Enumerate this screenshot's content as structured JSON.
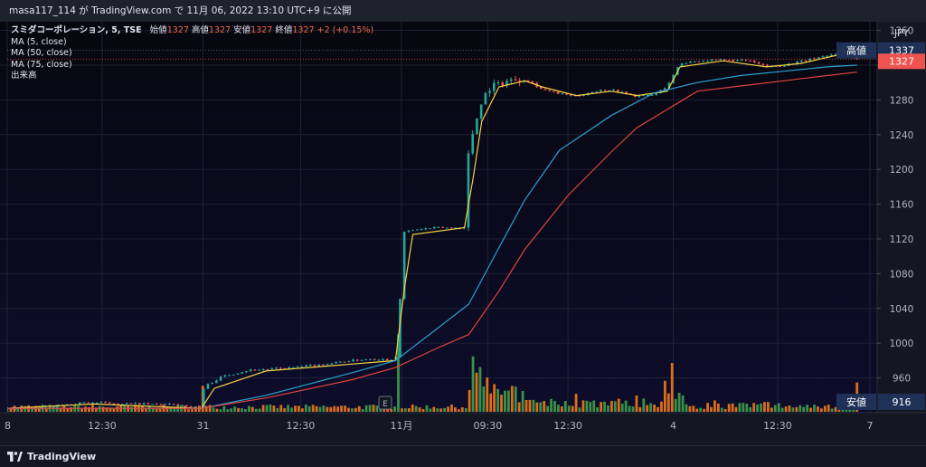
{
  "header": {
    "publish_info": "masa117_114 が TradingView.com で 11月 06, 2022 13:10 UTC+9 に公開"
  },
  "legend": {
    "symbol_line": "スミダコーポレーション, 5, TSE",
    "open_label": "始値",
    "open": "1327",
    "high_label": "高値",
    "high": "1327",
    "low_label": "安値",
    "low": "1327",
    "close_label": "終値",
    "close": "1327",
    "change": "+2 (+0.15%)",
    "ma5": "MA (5, close)",
    "ma50": "MA (50, close)",
    "ma75": "MA (75, close)",
    "volume": "出来高"
  },
  "footer": {
    "brand": "TradingView"
  },
  "colors": {
    "background": "#0d0d2b",
    "up": "#26a69a",
    "down": "#ef5350",
    "ma5": "#f5d142",
    "ma50": "#2aa1d1",
    "ma75": "#e0443d",
    "vol_up": "#3c9a4a",
    "vol_down": "#e8741a"
  },
  "chart_data": {
    "type": "candlestick",
    "title": "スミダコーポレーション, 5, TSE",
    "currency": "JPY",
    "ylim": [
      920,
      1370
    ],
    "y_ticks": [
      1360,
      1320,
      1280,
      1240,
      1200,
      1160,
      1120,
      1080,
      1040,
      1000,
      960
    ],
    "x_ticks": [
      {
        "label": "8",
        "t": 0
      },
      {
        "label": "12:30",
        "t": 0.11
      },
      {
        "label": "31",
        "t": 0.227
      },
      {
        "label": "12:30",
        "t": 0.34
      },
      {
        "label": "11月",
        "t": 0.457
      },
      {
        "label": "09:30",
        "t": 0.557
      },
      {
        "label": "12:30",
        "t": 0.65
      },
      {
        "label": "4",
        "t": 0.772
      },
      {
        "label": "12:30",
        "t": 0.893
      },
      {
        "label": "7",
        "t": 1.0
      }
    ],
    "price_labels": [
      {
        "name": "高値",
        "value": "1337"
      },
      {
        "name": "終値",
        "value": "1327"
      },
      {
        "name": "安値",
        "value": "916"
      }
    ],
    "ohlc_path": [
      [
        0,
        925
      ],
      [
        0.03,
        925
      ],
      [
        0.06,
        928
      ],
      [
        0.09,
        932
      ],
      [
        0.12,
        931
      ],
      [
        0.16,
        930
      ],
      [
        0.2,
        929
      ],
      [
        0.225,
        925
      ],
      [
        0.228,
        950
      ],
      [
        0.25,
        962
      ],
      [
        0.28,
        969
      ],
      [
        0.32,
        971
      ],
      [
        0.36,
        975
      ],
      [
        0.39,
        979
      ],
      [
        0.42,
        982
      ],
      [
        0.45,
        981
      ],
      [
        0.453,
        1010
      ],
      [
        0.46,
        1128
      ],
      [
        0.475,
        1131
      ],
      [
        0.5,
        1133
      ],
      [
        0.53,
        1133
      ],
      [
        0.535,
        1225
      ],
      [
        0.55,
        1280
      ],
      [
        0.56,
        1295
      ],
      [
        0.58,
        1302
      ],
      [
        0.6,
        1305
      ],
      [
        0.62,
        1292
      ],
      [
        0.64,
        1287
      ],
      [
        0.66,
        1284
      ],
      [
        0.68,
        1290
      ],
      [
        0.7,
        1292
      ],
      [
        0.715,
        1288
      ],
      [
        0.73,
        1284
      ],
      [
        0.75,
        1286
      ],
      [
        0.765,
        1296
      ],
      [
        0.78,
        1322
      ],
      [
        0.8,
        1325
      ],
      [
        0.83,
        1326
      ],
      [
        0.86,
        1325
      ],
      [
        0.88,
        1318
      ],
      [
        0.9,
        1320
      ],
      [
        0.92,
        1324
      ],
      [
        0.94,
        1329
      ],
      [
        0.96,
        1333
      ],
      [
        0.975,
        1330
      ],
      [
        0.985,
        1327
      ]
    ],
    "series": [
      {
        "name": "MA (5, close)",
        "points": [
          [
            0,
            925
          ],
          [
            0.1,
            930
          ],
          [
            0.225,
            925
          ],
          [
            0.24,
            948
          ],
          [
            0.3,
            968
          ],
          [
            0.45,
            980
          ],
          [
            0.46,
            1060
          ],
          [
            0.47,
            1125
          ],
          [
            0.53,
            1133
          ],
          [
            0.54,
            1190
          ],
          [
            0.55,
            1255
          ],
          [
            0.57,
            1295
          ],
          [
            0.6,
            1302
          ],
          [
            0.62,
            1295
          ],
          [
            0.66,
            1285
          ],
          [
            0.7,
            1290
          ],
          [
            0.73,
            1285
          ],
          [
            0.765,
            1290
          ],
          [
            0.78,
            1318
          ],
          [
            0.83,
            1325
          ],
          [
            0.88,
            1318
          ],
          [
            0.92,
            1322
          ],
          [
            0.96,
            1331
          ],
          [
            0.985,
            1328
          ]
        ]
      },
      {
        "name": "MA (50, close)",
        "points": [
          [
            0,
            925
          ],
          [
            0.225,
            925
          ],
          [
            0.3,
            940
          ],
          [
            0.4,
            966
          ],
          [
            0.45,
            980
          ],
          [
            0.5,
            1018
          ],
          [
            0.535,
            1045
          ],
          [
            0.57,
            1110
          ],
          [
            0.6,
            1165
          ],
          [
            0.64,
            1222
          ],
          [
            0.7,
            1262
          ],
          [
            0.75,
            1288
          ],
          [
            0.8,
            1300
          ],
          [
            0.85,
            1308
          ],
          [
            0.9,
            1313
          ],
          [
            0.95,
            1318
          ],
          [
            0.985,
            1320
          ]
        ]
      },
      {
        "name": "MA (75, close)",
        "points": [
          [
            0,
            925
          ],
          [
            0.225,
            925
          ],
          [
            0.3,
            937
          ],
          [
            0.4,
            958
          ],
          [
            0.45,
            972
          ],
          [
            0.5,
            995
          ],
          [
            0.535,
            1010
          ],
          [
            0.57,
            1060
          ],
          [
            0.6,
            1108
          ],
          [
            0.65,
            1170
          ],
          [
            0.7,
            1220
          ],
          [
            0.73,
            1248
          ],
          [
            0.8,
            1290
          ],
          [
            0.85,
            1296
          ],
          [
            0.9,
            1302
          ],
          [
            0.95,
            1308
          ],
          [
            0.985,
            1312
          ]
        ]
      }
    ],
    "volume_spikes": [
      {
        "t": 0.227,
        "v": 0.32,
        "up": false
      },
      {
        "t": 0.455,
        "v": 0.95,
        "up": true
      },
      {
        "t": 0.54,
        "v": 0.68,
        "up": true
      },
      {
        "t": 0.545,
        "v": 0.48,
        "up": false
      },
      {
        "t": 0.55,
        "v": 0.55,
        "up": true
      },
      {
        "t": 0.558,
        "v": 0.42,
        "up": false
      },
      {
        "t": 0.565,
        "v": 0.34,
        "up": false
      },
      {
        "t": 0.57,
        "v": 0.28,
        "up": true
      },
      {
        "t": 0.66,
        "v": 0.22,
        "up": false
      },
      {
        "t": 0.73,
        "v": 0.2,
        "up": false
      },
      {
        "t": 0.764,
        "v": 0.38,
        "up": false
      },
      {
        "t": 0.77,
        "v": 0.6,
        "up": false
      },
      {
        "t": 0.82,
        "v": 0.14,
        "up": false
      },
      {
        "t": 0.88,
        "v": 0.12,
        "up": false
      },
      {
        "t": 0.984,
        "v": 0.36,
        "up": false
      }
    ]
  }
}
